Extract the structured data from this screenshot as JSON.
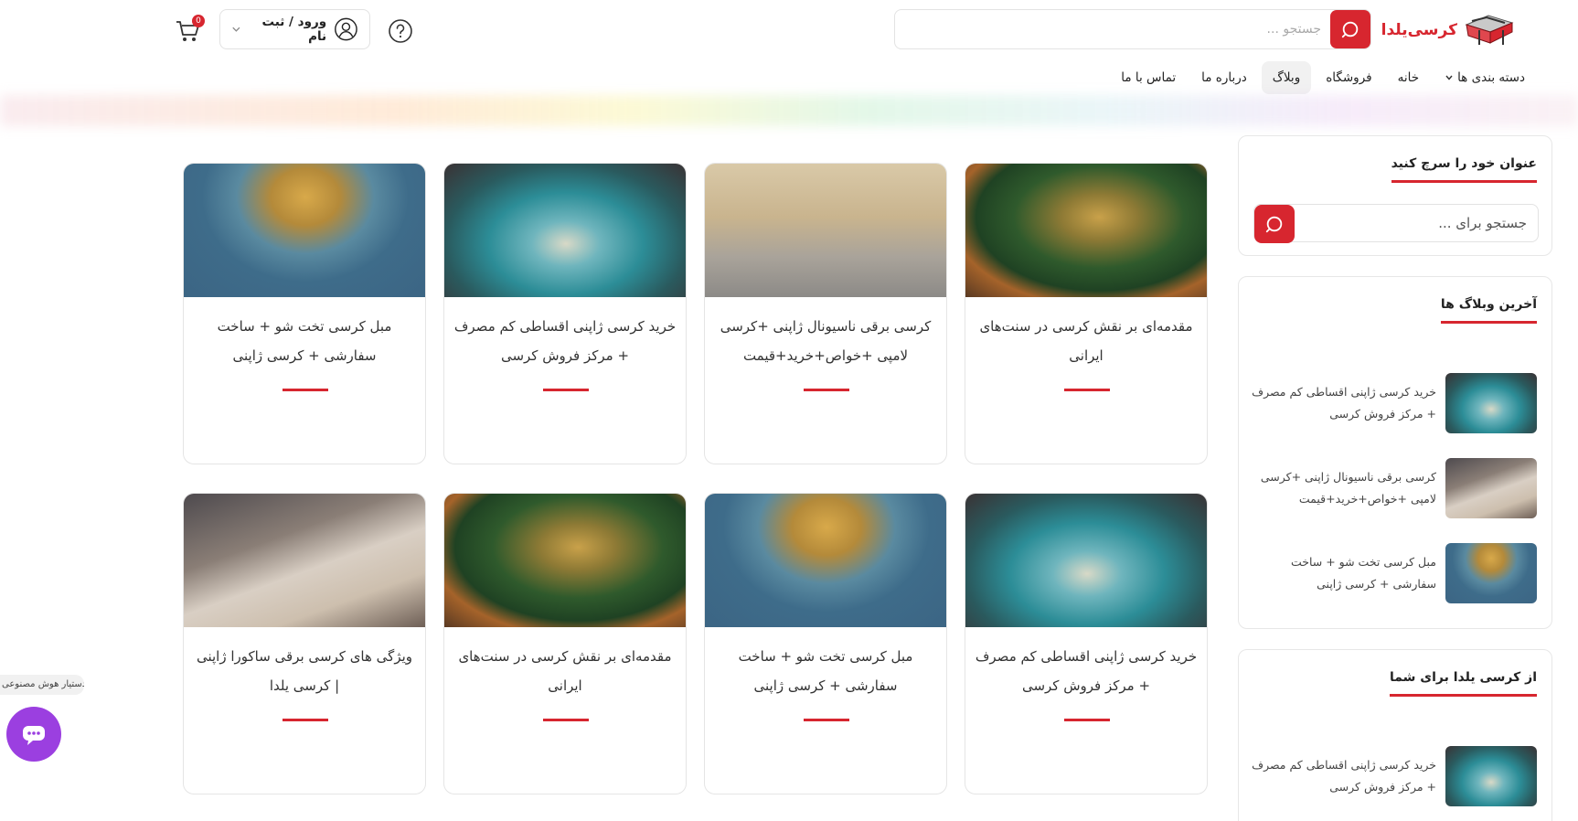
{
  "header": {
    "logo_text": "کرسی‌یلدا",
    "search_placeholder": "جستجو ...",
    "login_label": "ورود / ثبت نام",
    "cart_count": "0"
  },
  "nav": {
    "items": [
      {
        "label": "دسته بندی ها",
        "has_dropdown": true
      },
      {
        "label": "خانه"
      },
      {
        "label": "فروشگاه"
      },
      {
        "label": "وبلاگ",
        "active": true
      },
      {
        "label": "درباره ما"
      },
      {
        "label": "تماس با ما"
      }
    ]
  },
  "sidebar": {
    "search_box": {
      "title": "عنوان خود را سرچ کنید",
      "placeholder": "جستجو برای ..."
    },
    "latest": {
      "title": "آخرین وبلاگ ها",
      "posts": [
        {
          "title": "خرید کرسی ژاپنی اقساطی کم مصرف + مرکز فروش کرسی"
        },
        {
          "title": "کرسی برقی ناسیونال ژاپنی +کرسی لامپی +خواص+خرید+قیمت"
        },
        {
          "title": "مبل کرسی تخت شو + ساخت سفارشی + کرسی ژاپنی"
        }
      ]
    },
    "for_you": {
      "title": "از کرسی یلدا برای شما",
      "posts": [
        {
          "title": "خرید کرسی ژاپنی اقساطی کم مصرف + مرکز فروش کرسی"
        }
      ]
    }
  },
  "posts": [
    {
      "title": "مقدمه‌ای بر نقش کرسی در سنت‌های ایرانی"
    },
    {
      "title": "کرسی برقی ناسیونال ژاپنی +کرسی لامپی +خواص+خرید+قیمت"
    },
    {
      "title": "خرید کرسی ژاپنی اقساطی کم مصرف + مرکز فروش کرسی"
    },
    {
      "title": "مبل کرسی تخت شو + ساخت سفارشی + کرسی ژاپنی"
    },
    {
      "title": "خرید کرسی ژاپنی اقساطی کم مصرف + مرکز فروش کرسی"
    },
    {
      "title": "مبل کرسی تخت شو + ساخت سفارشی + کرسی ژاپنی"
    },
    {
      "title": "مقدمه‌ای بر نقش کرسی در سنت‌های ایرانی"
    },
    {
      "title": "ویژگی های کرسی برقی ساکورا ژاپنی | کرسی یلدا"
    }
  ],
  "chat": {
    "label": "دستیار هوش مصنوعی"
  },
  "colors": {
    "accent": "#d7262f",
    "chat": "#9b3fe0"
  }
}
